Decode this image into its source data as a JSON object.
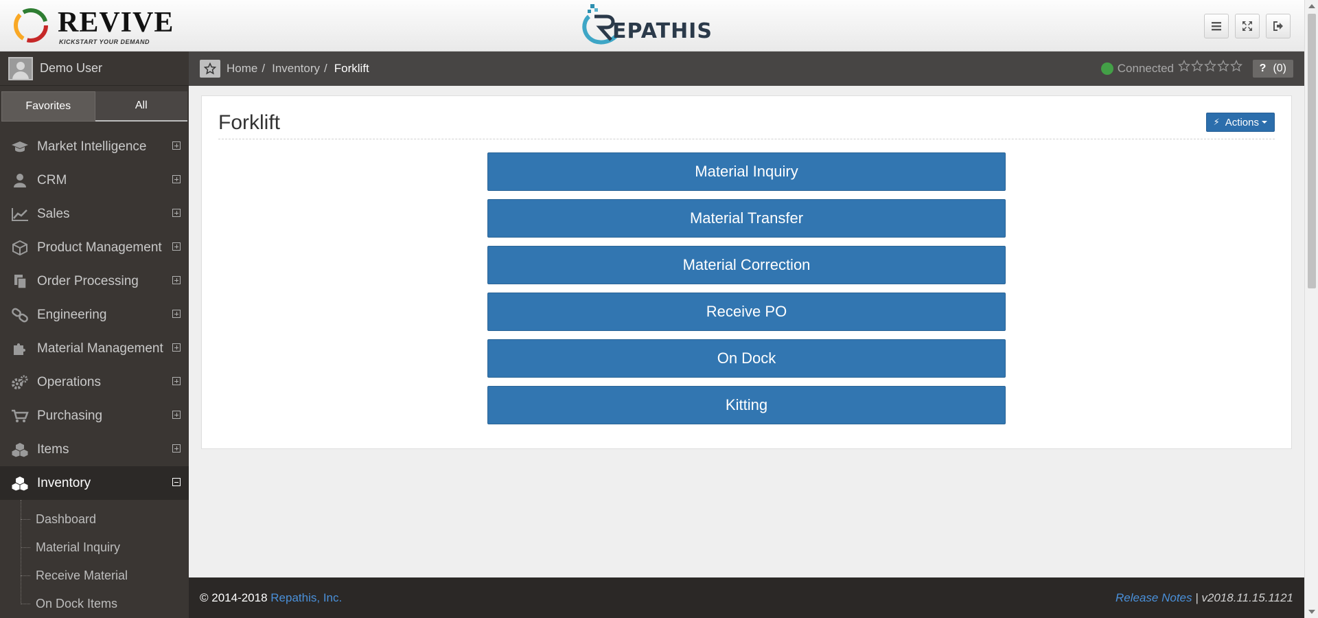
{
  "header": {
    "brand_name": "REVIVE",
    "brand_tagline": "KICKSTART YOUR DEMAND",
    "center_logo_text": "EPATHIS",
    "buttons": [
      "menu-icon",
      "fullscreen-icon",
      "logout-icon"
    ]
  },
  "user": {
    "name": "Demo User"
  },
  "tabs": {
    "favorites": "Favorites",
    "all": "All"
  },
  "menu": [
    {
      "label": "Market Intelligence",
      "icon": "graduation-cap-icon"
    },
    {
      "label": "CRM",
      "icon": "user-icon"
    },
    {
      "label": "Sales",
      "icon": "line-chart-icon"
    },
    {
      "label": "Product Management",
      "icon": "cube-icon"
    },
    {
      "label": "Order Processing",
      "icon": "files-icon"
    },
    {
      "label": "Engineering",
      "icon": "link-icon"
    },
    {
      "label": "Material Management",
      "icon": "puzzle-icon"
    },
    {
      "label": "Operations",
      "icon": "gears-icon"
    },
    {
      "label": "Purchasing",
      "icon": "cart-icon"
    },
    {
      "label": "Items",
      "icon": "cubes-icon"
    },
    {
      "label": "Inventory",
      "icon": "cubes-icon"
    }
  ],
  "submenu": [
    "Dashboard",
    "Material Inquiry",
    "Receive Material",
    "On Dock Items"
  ],
  "breadcrumb": {
    "home": "Home",
    "inventory": "Inventory",
    "current": "Forklift"
  },
  "status": {
    "label": "Connected",
    "color": "#43a047"
  },
  "help": {
    "icon": "?",
    "count": "(0)"
  },
  "page": {
    "title": "Forklift",
    "actions_label": "Actions"
  },
  "buttons": [
    "Material Inquiry",
    "Material Transfer",
    "Material Correction",
    "Receive PO",
    "On Dock",
    "Kitting"
  ],
  "footer": {
    "copyright": "© 2014-2018",
    "company": "Repathis, Inc.",
    "release_notes": "Release Notes",
    "version": "| v2018.11.15.1121"
  },
  "colors": {
    "primary_button": "#3276b1",
    "sidebar": "#3a3633",
    "ribbon": "#474544"
  }
}
